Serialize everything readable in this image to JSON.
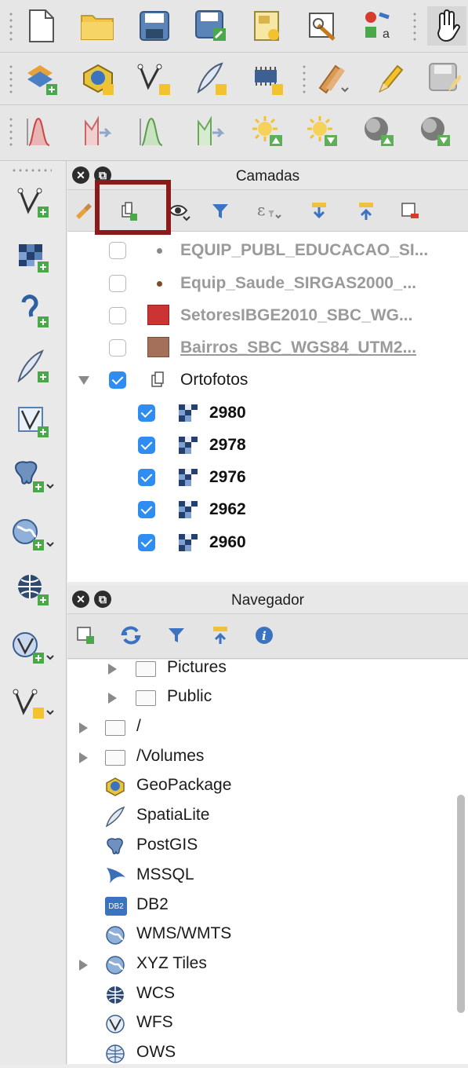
{
  "toolbar": {
    "row1": [
      "new-project-icon",
      "open-project-icon",
      "save-project-icon",
      "save-as-icon",
      "new-print-layout-icon",
      "layout-manager-icon",
      "style-manager-icon",
      "pan-map-icon"
    ],
    "row2": [
      "add-layer-icon",
      "add-vector-icon",
      "add-delimited-text-icon",
      "add-spatialite-icon",
      "add-raster-icon",
      "current-edits-icon",
      "toggle-editing-icon",
      "save-edits-icon"
    ],
    "row3": [
      "profile-red-icon",
      "profile-edit-icon",
      "profile-green-icon",
      "profile-edit-green-icon",
      "sun-up-icon",
      "sun-down-icon",
      "globe-up-icon",
      "globe-down-icon"
    ]
  },
  "left_toolbar": [
    "add-vector-layer-icon",
    "add-raster-layer-icon",
    "add-mesh-layer-icon",
    "add-spatialite-layer-icon",
    "add-virtual-layer-icon",
    "add-postgis-layer-icon",
    "add-wms-layer-icon",
    "add-wcs-layer-icon",
    "add-wfs-layer-icon",
    "new-shapefile-icon"
  ],
  "layers_panel": {
    "title": "Camadas",
    "tools": [
      "style-icon",
      "add-group-icon",
      "visibility-icon",
      "filter-icon",
      "expression-filter-icon",
      "expand-all-icon",
      "collapse-all-icon",
      "remove-layer-icon"
    ],
    "items": [
      {
        "name": "EQUIP_PUBL_EDUCACAO_SI...",
        "checked": false,
        "symbol": "point-grey"
      },
      {
        "name": "Equip_Saude_SIRGAS2000_...",
        "checked": false,
        "symbol": "point-brown"
      },
      {
        "name": "SetoresIBGE2010_SBC_WG...",
        "checked": false,
        "symbol": "polygon-red",
        "color": "#cc3333"
      },
      {
        "name": "Bairros_SBC_WGS84_UTM2...",
        "checked": false,
        "symbol": "polygon-brown",
        "color": "#a4705a"
      }
    ],
    "group": {
      "name": "Ortofotos",
      "checked": true
    },
    "children": [
      "2980",
      "2978",
      "2976",
      "2962",
      "2960"
    ]
  },
  "browser_panel": {
    "title": "Navegador",
    "entries": [
      {
        "label": "Pictures",
        "type": "folder",
        "expandable": true
      },
      {
        "label": "Public",
        "type": "folder",
        "expandable": true
      },
      {
        "label": "/",
        "type": "folder",
        "expandable": true
      },
      {
        "label": "/Volumes",
        "type": "folder",
        "expandable": true
      },
      {
        "label": "GeoPackage",
        "type": "geopackage-icon",
        "expandable": false
      },
      {
        "label": "SpatiaLite",
        "type": "spatialite-icon",
        "expandable": false
      },
      {
        "label": "PostGIS",
        "type": "postgis-icon",
        "expandable": false
      },
      {
        "label": "MSSQL",
        "type": "mssql-icon",
        "expandable": false
      },
      {
        "label": "DB2",
        "type": "db2-icon",
        "expandable": false
      },
      {
        "label": "WMS/WMTS",
        "type": "wms-icon",
        "expandable": false
      },
      {
        "label": "XYZ Tiles",
        "type": "xyz-icon",
        "expandable": true
      },
      {
        "label": "WCS",
        "type": "wcs-icon",
        "expandable": false
      },
      {
        "label": "WFS",
        "type": "wfs-icon",
        "expandable": false
      },
      {
        "label": "OWS",
        "type": "ows-icon",
        "expandable": false
      }
    ],
    "db2_badge": "DB2"
  },
  "colors": {
    "accent": "#2f8cf0",
    "highlight": "#8b1a1a"
  }
}
